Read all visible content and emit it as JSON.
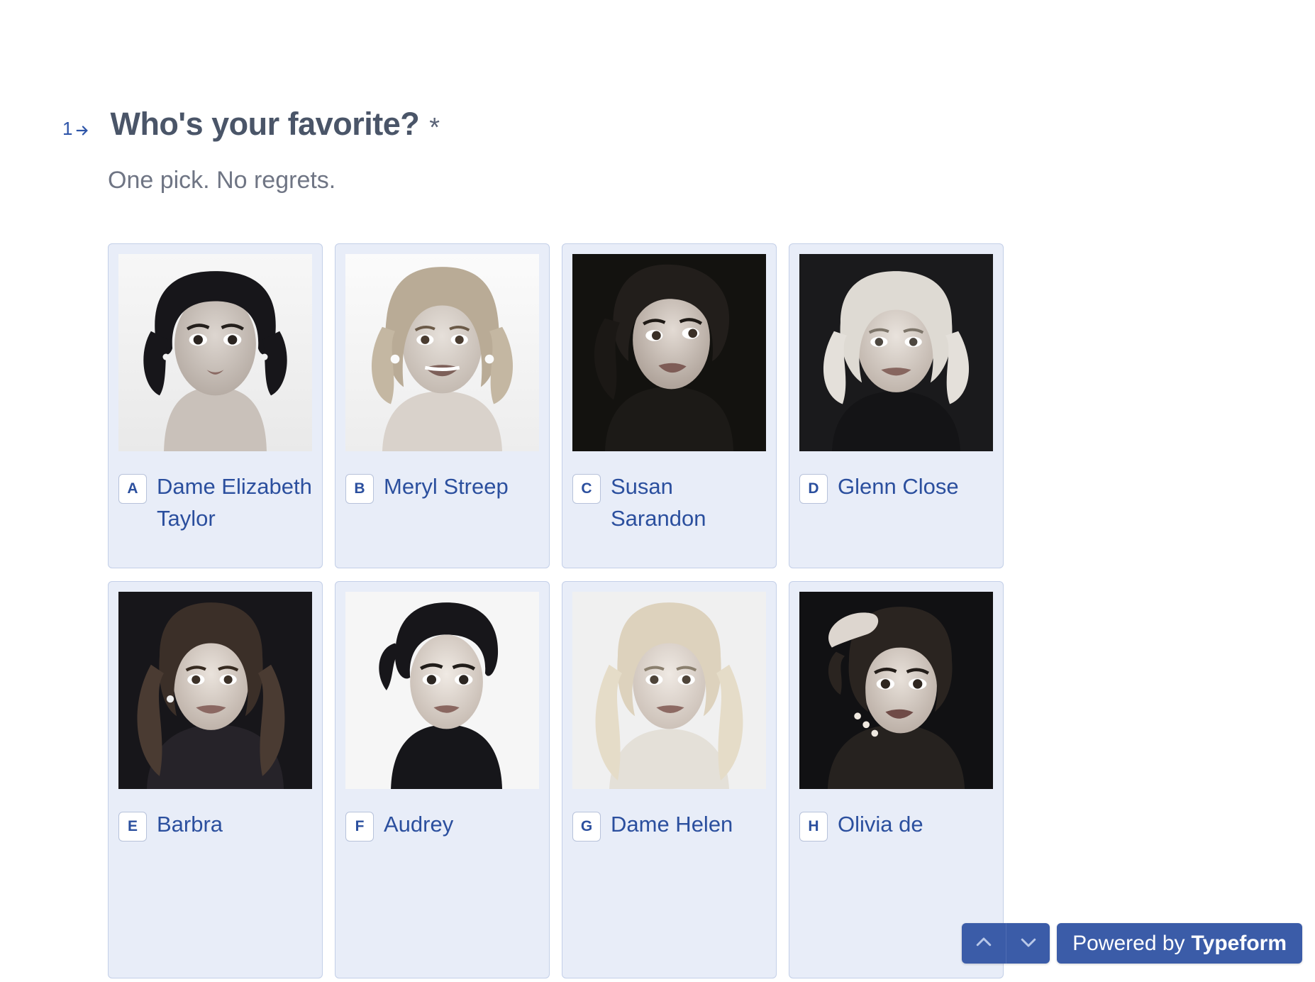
{
  "question": {
    "number": "1",
    "arrow_icon": "arrow-right-icon",
    "title": "Who's your favorite?",
    "required_marker": "*",
    "subtitle": "One pick. No regrets."
  },
  "colors": {
    "accent": "#3b5ca8",
    "card_bg": "#e8edf8",
    "card_border": "#c3cfe8",
    "label_text": "#2b4f9e",
    "title_text": "#4a5568",
    "subtitle_text": "#6f7584"
  },
  "choices": [
    {
      "key": "A",
      "label": "Dame Elizabeth Taylor",
      "image_alt": "portrait-elizabeth-taylor"
    },
    {
      "key": "B",
      "label": "Meryl Streep",
      "image_alt": "portrait-meryl-streep"
    },
    {
      "key": "C",
      "label": "Susan Sarandon",
      "image_alt": "portrait-susan-sarandon"
    },
    {
      "key": "D",
      "label": "Glenn Close",
      "image_alt": "portrait-glenn-close"
    },
    {
      "key": "E",
      "label": "Barbra",
      "image_alt": "portrait-barbra-streisand"
    },
    {
      "key": "F",
      "label": "Audrey",
      "image_alt": "portrait-audrey-hepburn"
    },
    {
      "key": "G",
      "label": "Dame Helen",
      "image_alt": "portrait-helen-mirren"
    },
    {
      "key": "H",
      "label": "Olivia de",
      "image_alt": "portrait-olivia-de-havilland"
    }
  ],
  "footer": {
    "nav_up_icon": "chevron-up-icon",
    "nav_down_icon": "chevron-down-icon",
    "brand_prefix": "Powered by",
    "brand_name": "Typeform"
  }
}
